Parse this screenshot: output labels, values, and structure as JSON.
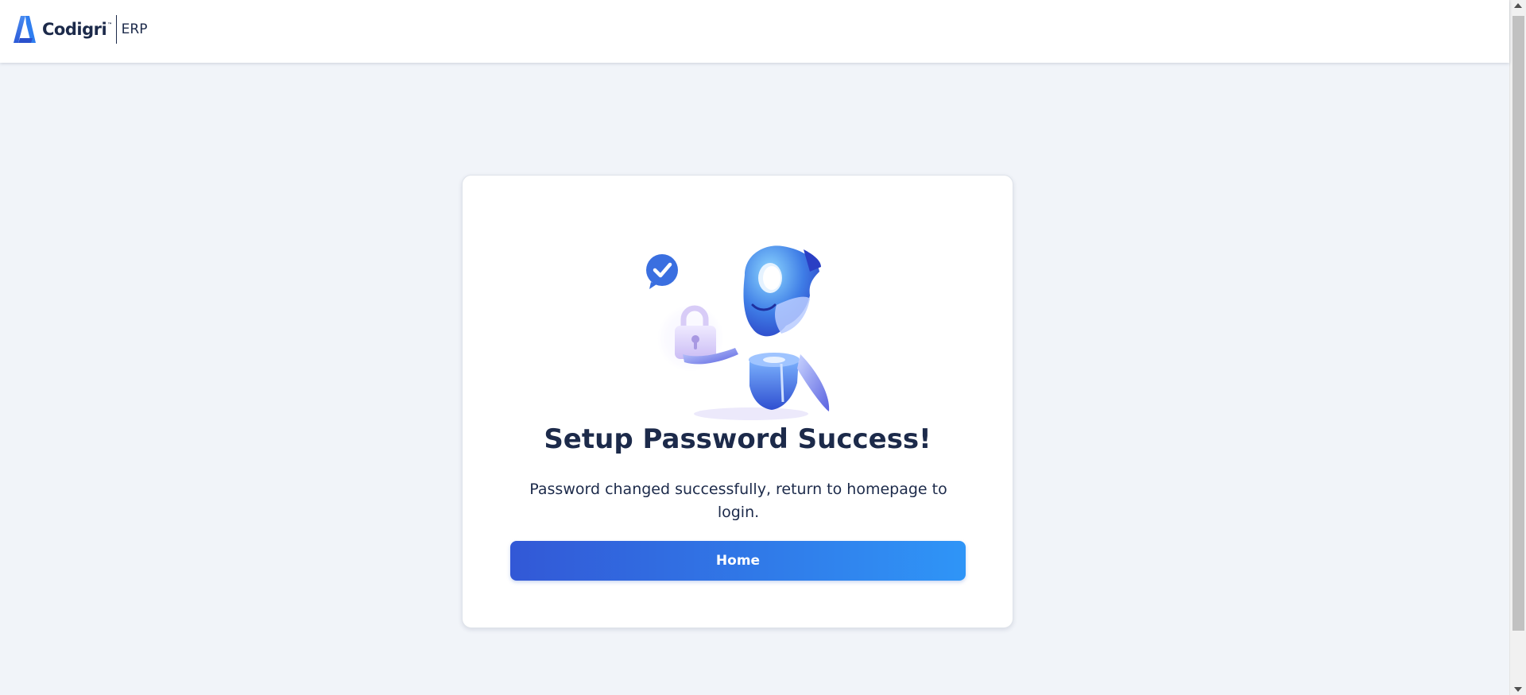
{
  "header": {
    "brand_name": "Codigri",
    "brand_tm": "™",
    "brand_suffix": "ERP",
    "logo_icon": "codigri-logo-icon"
  },
  "card": {
    "illustration_icon": "robot-lock-success-illustration",
    "title": "Setup Password Success!",
    "message": "Password changed successfully, return to homepage to login.",
    "home_button_label": "Home"
  },
  "colors": {
    "background": "#f1f4f9",
    "title_text": "#1c2a4a",
    "button_gradient_start": "#3258d6",
    "button_gradient_end": "#2f95f7",
    "accent_check": "#3a6fe0"
  }
}
